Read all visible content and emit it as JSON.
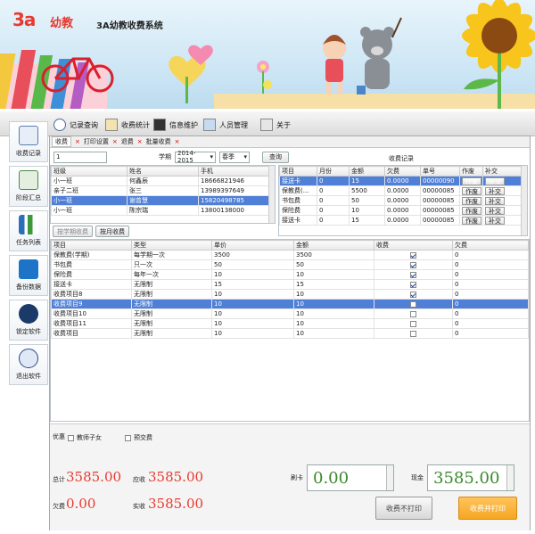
{
  "header": {
    "logo_mark": "3a",
    "logo_text": "幼教",
    "system_title": "3A幼教收费系统"
  },
  "toolbar": {
    "tabs": [
      {
        "label": "记录查询",
        "icon": "magnifier-icon"
      },
      {
        "label": "收费统计",
        "icon": "pen-icon"
      },
      {
        "label": "信息维护",
        "icon": "binoculars-icon"
      },
      {
        "label": "人员管理",
        "icon": "user-icon"
      },
      {
        "label": "关于",
        "icon": "help-icon"
      }
    ]
  },
  "sidebar": {
    "items": [
      {
        "label": "收费记录",
        "icon": "document-pen-icon",
        "color": "#2a6fb8"
      },
      {
        "label": "阶段汇总",
        "icon": "stack-icon",
        "color": "#3a8a3a"
      },
      {
        "label": "任务列表",
        "icon": "chart-icon",
        "color": "#2a6fb8"
      },
      {
        "label": "备份数据",
        "icon": "backup-icon",
        "color": "#1c73c8"
      },
      {
        "label": "锁定软件",
        "icon": "lock-icon",
        "color": "#1b3a6a"
      },
      {
        "label": "退出软件",
        "icon": "exit-user-icon",
        "color": "#2a4a8a"
      }
    ]
  },
  "subtabs": [
    {
      "label": "收费"
    },
    {
      "label": "打印设置"
    },
    {
      "label": "退费"
    },
    {
      "label": "批量收费"
    }
  ],
  "query": {
    "input_value": "1",
    "term_label": "学期",
    "term_value": "2014-2015",
    "season_value": "春季",
    "query_button": "查询"
  },
  "students": {
    "columns": [
      "班级",
      "姓名",
      "手机"
    ],
    "rows": [
      [
        "小一班",
        "何鑫辰",
        "18666821946"
      ],
      [
        "亲子二班",
        "张三",
        "13989397649"
      ],
      [
        "小一班",
        "谢曾慧",
        "15820498785"
      ],
      [
        "小一班",
        "陈宗瑞",
        "13800138000"
      ]
    ],
    "selected": 2
  },
  "student_buttons": {
    "by_term": "按学期收费",
    "by_month": "按月收费"
  },
  "records": {
    "title": "收费记录",
    "columns": [
      "项目",
      "月份",
      "金额",
      "欠费",
      "单号",
      "作废",
      "补交"
    ],
    "void_label": "作废",
    "makeup_label": "补交",
    "rows": [
      [
        "接送卡",
        "0",
        "15",
        "0.0000",
        "00000090"
      ],
      [
        "保教费(...",
        "0",
        "5500",
        "0.0000",
        "00000085"
      ],
      [
        "书包费",
        "0",
        "50",
        "0.0000",
        "00000085"
      ],
      [
        "保险费",
        "0",
        "10",
        "0.0000",
        "00000085"
      ],
      [
        "接送卡",
        "0",
        "15",
        "0.0000",
        "00000085"
      ]
    ],
    "selected": 0
  },
  "items": {
    "columns": [
      "项目",
      "类型",
      "单价",
      "金额",
      "收费",
      "欠费"
    ],
    "rows": [
      {
        "cells": [
          "保教费(学期)",
          "每学期一次",
          "3500",
          "3500"
        ],
        "checked": true,
        "owed": "0"
      },
      {
        "cells": [
          "书包费",
          "只一次",
          "50",
          "50"
        ],
        "checked": true,
        "owed": "0"
      },
      {
        "cells": [
          "保险费",
          "每年一次",
          "10",
          "10"
        ],
        "checked": true,
        "owed": "0"
      },
      {
        "cells": [
          "接送卡",
          "无限制",
          "15",
          "15"
        ],
        "checked": true,
        "owed": "0"
      },
      {
        "cells": [
          "收费项目8",
          "无限制",
          "10",
          "10"
        ],
        "checked": true,
        "owed": "0"
      },
      {
        "cells": [
          "收费项目9",
          "无限制",
          "10",
          "10"
        ],
        "checked": false,
        "owed": "0"
      },
      {
        "cells": [
          "收费项目10",
          "无限制",
          "10",
          "10"
        ],
        "checked": false,
        "owed": "0"
      },
      {
        "cells": [
          "收费项目11",
          "无限制",
          "10",
          "10"
        ],
        "checked": false,
        "owed": "0"
      },
      {
        "cells": [
          "收费项目",
          "无限制",
          "10",
          "10"
        ],
        "checked": false,
        "owed": "0"
      }
    ],
    "selected": 5
  },
  "discount": {
    "label": "优惠",
    "teacher_child": "教师子女",
    "prepay": "预交费"
  },
  "totals": {
    "total_label": "总计",
    "total_value": "3585.00",
    "due_label": "应收",
    "due_value": "3585.00",
    "owed_label": "欠费",
    "owed_value": "0.00",
    "received_label": "实收",
    "received_value": "3585.00",
    "card_label": "刷卡",
    "card_value": "0.00",
    "cash_label": "现金",
    "cash_value": "3585.00"
  },
  "actions": {
    "charge_no_print": "收费不打印",
    "charge_print": "收费并打印"
  },
  "colors": {
    "accent": "#4f7fd6",
    "red": "#e8392f",
    "green": "#3c8a2e",
    "orange": "#f5a623"
  }
}
